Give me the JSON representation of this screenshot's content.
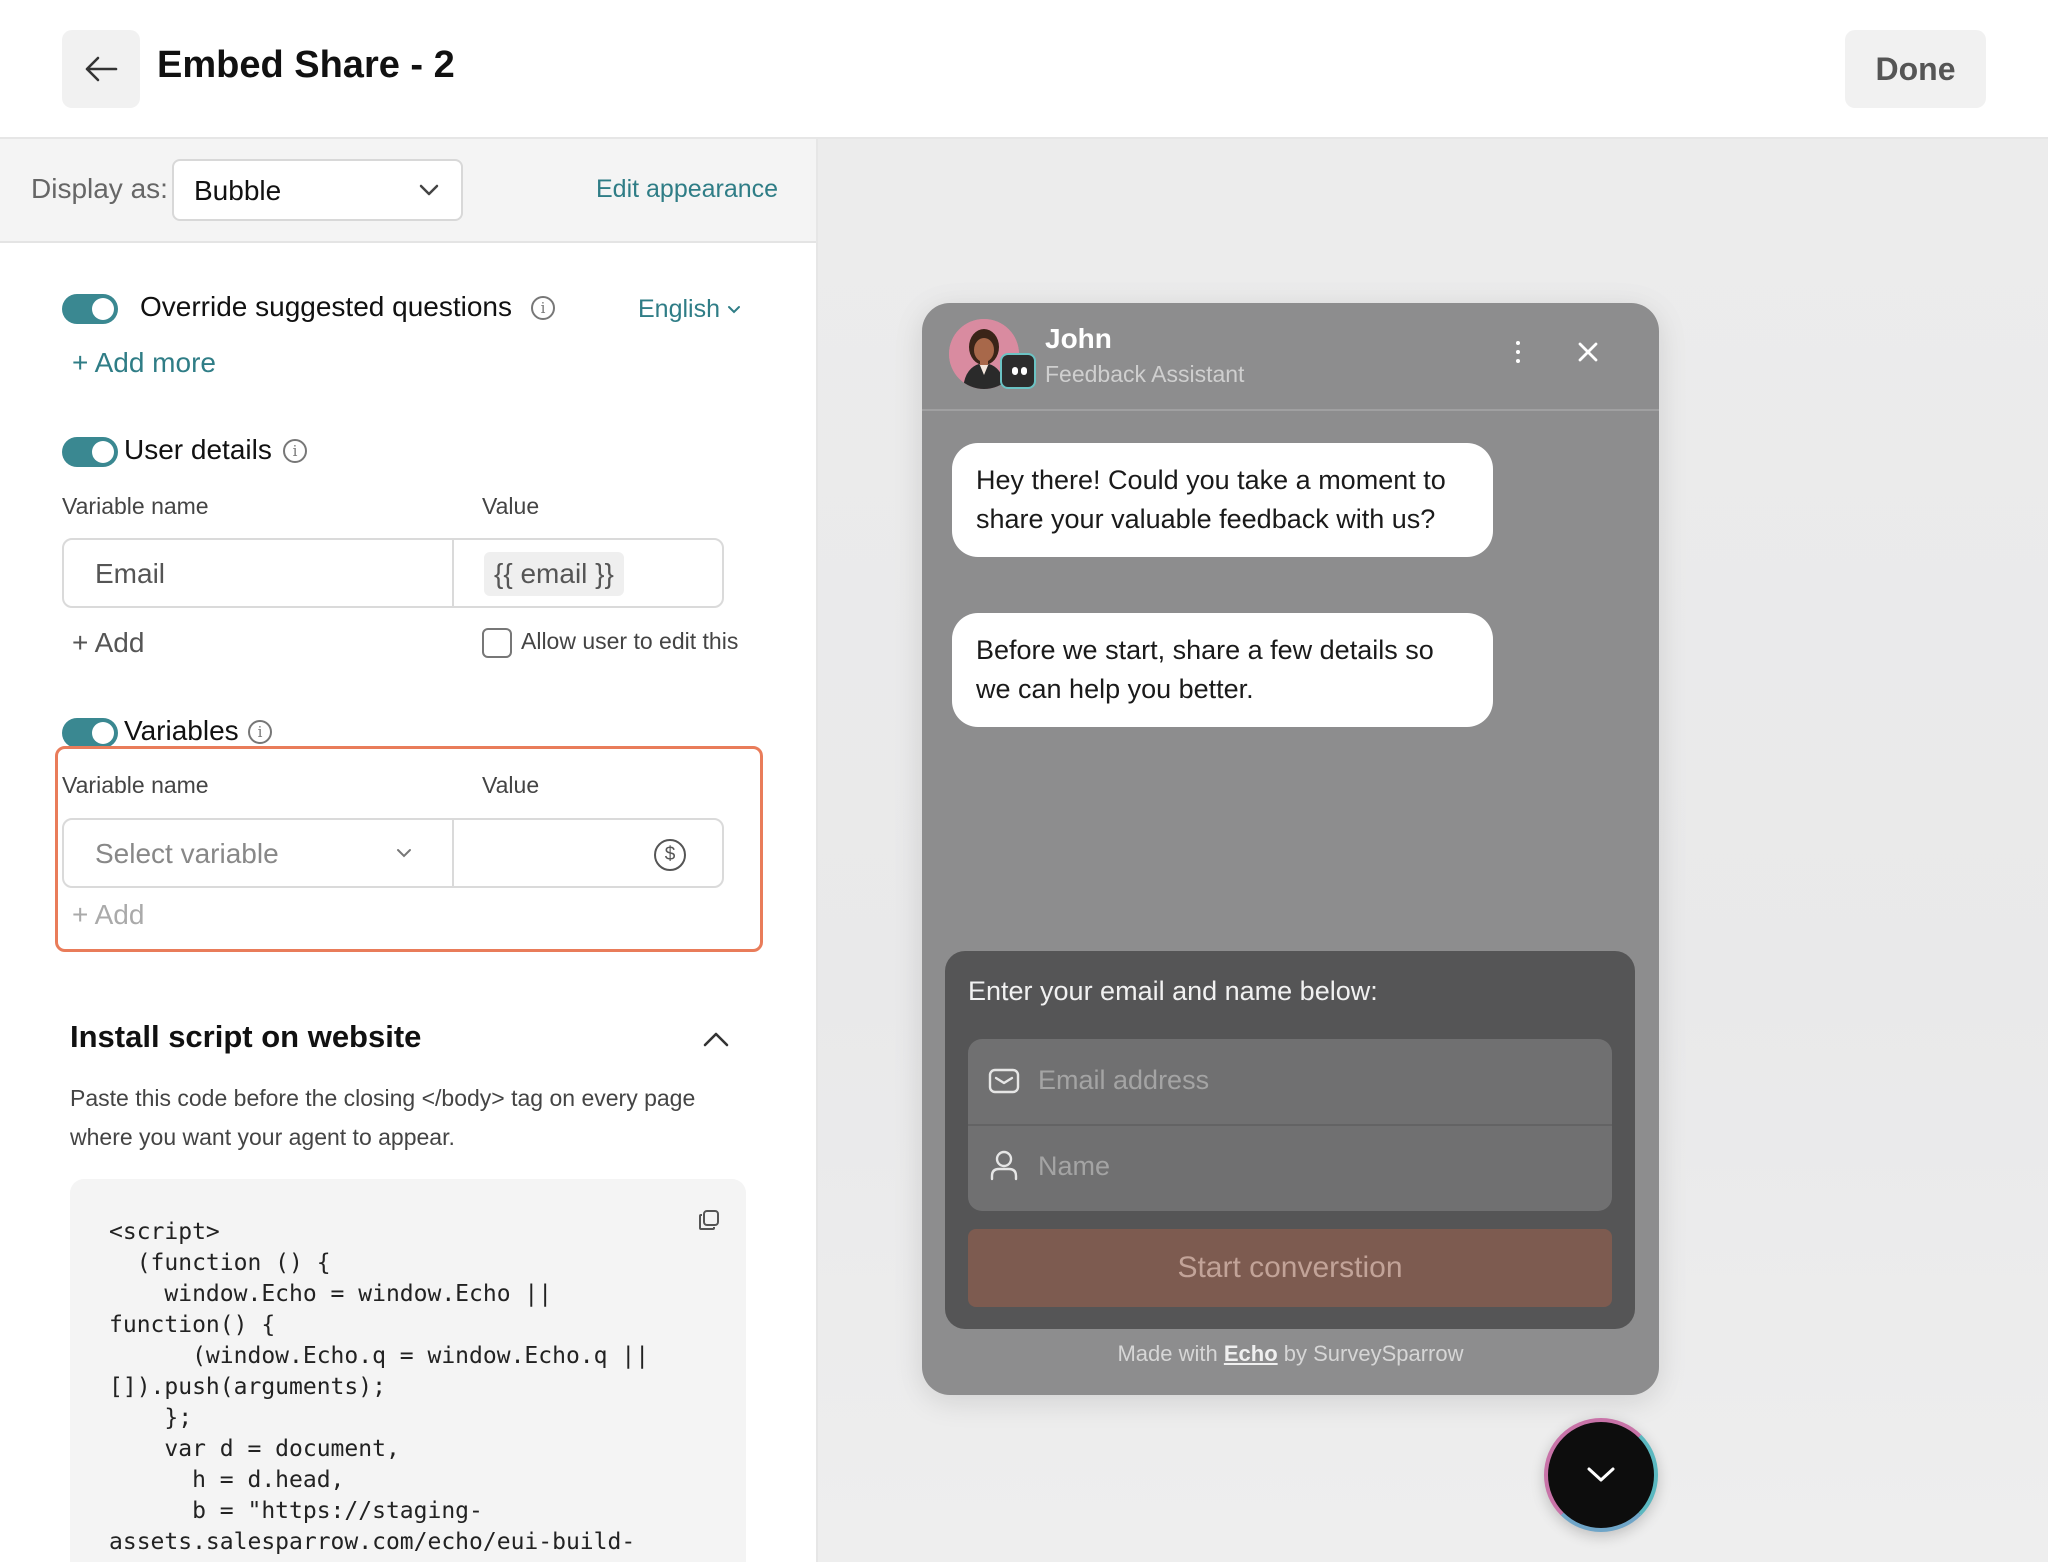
{
  "header": {
    "title": "Embed Share - 2",
    "done_label": "Done"
  },
  "display": {
    "label": "Display as:",
    "selected": "Bubble",
    "edit_appearance": "Edit appearance"
  },
  "override": {
    "label": "Override suggested questions",
    "enabled": true,
    "language": "English",
    "add_more": "+ Add more"
  },
  "user_details": {
    "label": "User details",
    "enabled": true,
    "col_name": "Variable name",
    "col_value": "Value",
    "row_name": "Email",
    "row_value": "{{ email }}",
    "add_label": "+ Add",
    "allow_edit_label": "Allow user to edit this",
    "allow_edit_checked": false
  },
  "variables": {
    "label": "Variables",
    "enabled": true,
    "col_name": "Variable name",
    "col_value": "Value",
    "select_placeholder": "Select variable",
    "add_label": "+ Add"
  },
  "install": {
    "title": "Install script on website",
    "description": "Paste this code before the closing </body> tag on every page where you want your agent to appear.",
    "code": "<script>\n  (function () {\n    window.Echo = window.Echo ||\nfunction() {\n      (window.Echo.q = window.Echo.q ||\n[]).push(arguments);\n    };\n    var d = document,\n      h = d.head,\n      b = \"https://staging-\nassets.salesparrow.com/echo/eui-build-"
  },
  "preview": {
    "agent_name": "John",
    "agent_role": "Feedback Assistant",
    "messages": [
      "Hey there! Could you take a moment to share your valuable feedback with us?",
      "Before we start, share a few details so we can help you better."
    ],
    "form_title": "Enter your email and name below:",
    "email_placeholder": "Email address",
    "name_placeholder": "Name",
    "start_button": "Start converstion",
    "footer_prefix": "Made with ",
    "footer_brand": "Echo",
    "footer_suffix": " by SurveySparrow"
  },
  "colors": {
    "accent": "#3a8891",
    "link": "#2f7d86",
    "highlight_border": "#e97c5a",
    "chat_bg": "#8d8d8e",
    "start_button_bg": "#7d5b50"
  },
  "icons": [
    "back-arrow-icon",
    "chevron-down-icon",
    "info-icon",
    "dollar-icon",
    "chevron-up-icon",
    "copy-icon",
    "more-vertical-icon",
    "close-icon",
    "mail-icon",
    "user-icon"
  ]
}
